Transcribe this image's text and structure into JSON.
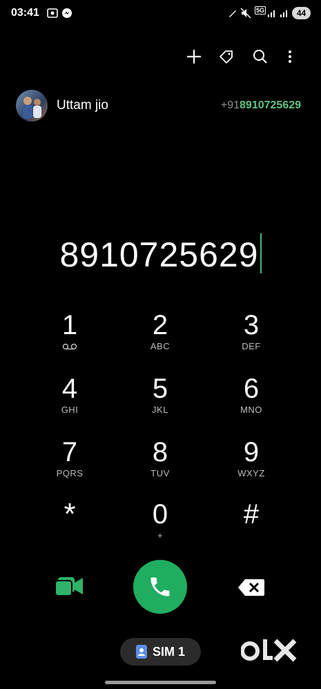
{
  "status_bar": {
    "time": "03:41",
    "network": "5G",
    "battery": "44"
  },
  "toolbar": {
    "icons": [
      "add-icon",
      "tag-icon",
      "search-icon",
      "more-vert-icon"
    ]
  },
  "suggestion": {
    "name": "Uttam jio",
    "prefix": "+91",
    "number": "8910725629"
  },
  "dialer": {
    "entered_number": "8910725629",
    "keys": [
      {
        "digit": "1",
        "sub": ""
      },
      {
        "digit": "2",
        "sub": "ABC"
      },
      {
        "digit": "3",
        "sub": "DEF"
      },
      {
        "digit": "4",
        "sub": "GHI"
      },
      {
        "digit": "5",
        "sub": "JKL"
      },
      {
        "digit": "6",
        "sub": "MNO"
      },
      {
        "digit": "7",
        "sub": "PQRS"
      },
      {
        "digit": "8",
        "sub": "TUV"
      },
      {
        "digit": "9",
        "sub": "WXYZ"
      },
      {
        "digit": "*",
        "sub": ""
      },
      {
        "digit": "0",
        "sub": "+"
      },
      {
        "digit": "#",
        "sub": ""
      }
    ]
  },
  "sim": {
    "label": "SIM 1"
  },
  "watermark": "OLX",
  "colors": {
    "call_green": "#20ad5f",
    "accent_green": "#5ec584",
    "video_green": "#2fb36a"
  }
}
